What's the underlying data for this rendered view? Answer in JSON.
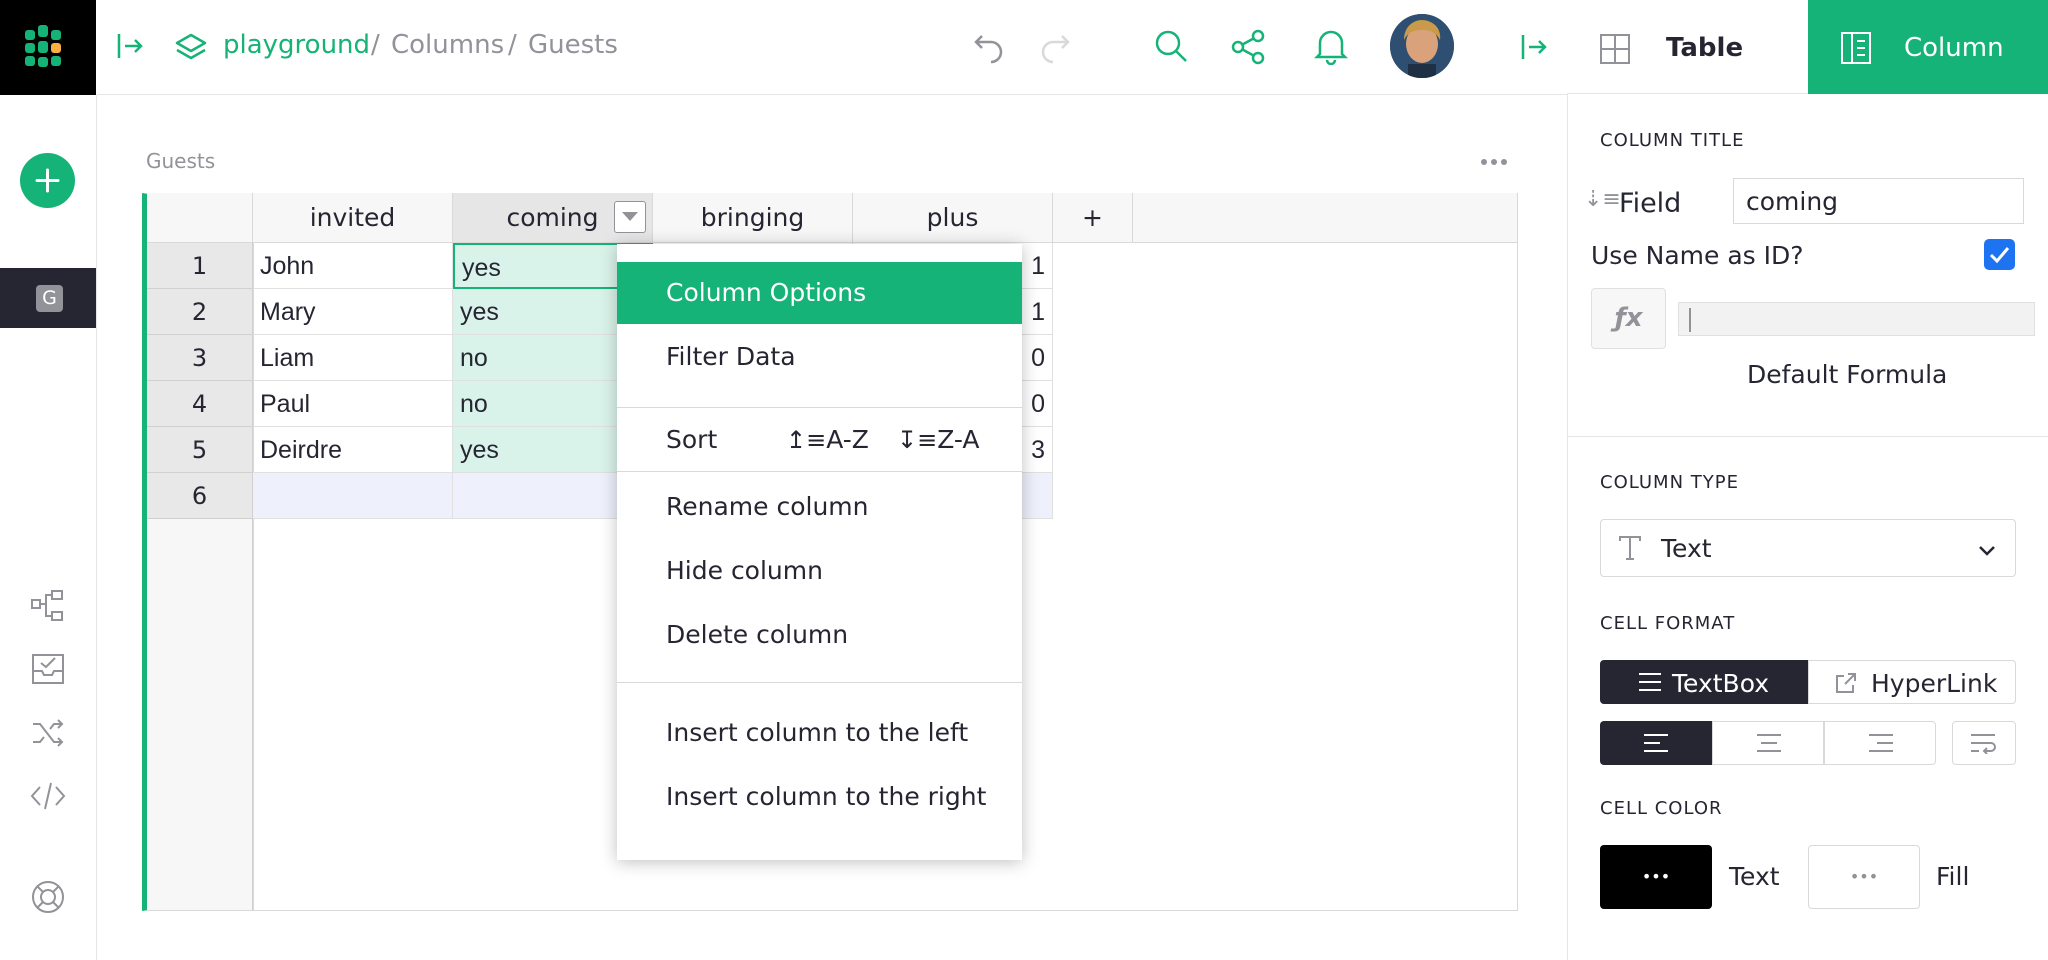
{
  "header": {
    "breadcrumb": {
      "doc": "playground",
      "sep1": "/",
      "page": "Columns",
      "sep2": "/",
      "section": "Guests"
    }
  },
  "section_title": "Guests",
  "grid": {
    "columns": [
      "invited",
      "coming",
      "bringing",
      "plus",
      "+"
    ],
    "rows": [
      {
        "num": "1",
        "invited": "John",
        "coming": "yes",
        "plus": "1"
      },
      {
        "num": "2",
        "invited": "Mary",
        "coming": "yes",
        "plus": "1"
      },
      {
        "num": "3",
        "invited": "Liam",
        "coming": "no",
        "plus": "0"
      },
      {
        "num": "4",
        "invited": "Paul",
        "coming": "no",
        "plus": "0"
      },
      {
        "num": "5",
        "invited": "Deirdre",
        "coming": "yes",
        "plus": "3"
      },
      {
        "num": "6",
        "invited": "",
        "coming": "",
        "plus": ""
      }
    ]
  },
  "menu": {
    "column_options": "Column Options",
    "filter_data": "Filter Data",
    "sort": "Sort",
    "sort_az": "A-Z",
    "sort_za": "Z-A",
    "rename": "Rename column",
    "hide": "Hide column",
    "delete": "Delete column",
    "insert_left": "Insert column to the left",
    "insert_right": "Insert column to the right"
  },
  "rail": {
    "doc_initial": "G"
  },
  "right_panel": {
    "tab_table": "Table",
    "tab_column": "Column",
    "column_title_label": "COLUMN TITLE",
    "field_label": "Field",
    "field_value": "coming",
    "use_name_as_id": "Use Name as ID?",
    "use_name_checked": true,
    "fx": "ƒx",
    "default_formula": "Default Formula",
    "column_type_label": "COLUMN TYPE",
    "column_type_value": "Text",
    "cell_format_label": "CELL FORMAT",
    "textbox": "TextBox",
    "hyperlink": "HyperLink",
    "cell_color_label": "CELL COLOR",
    "text_color_label": "Text",
    "fill_color_label": "Fill",
    "text_swatch_dots": "•••",
    "fill_swatch_dots": "•••"
  },
  "colors": {
    "accent": "#16b378",
    "dark": "#262633",
    "highlight_col": "#daf3ea"
  }
}
